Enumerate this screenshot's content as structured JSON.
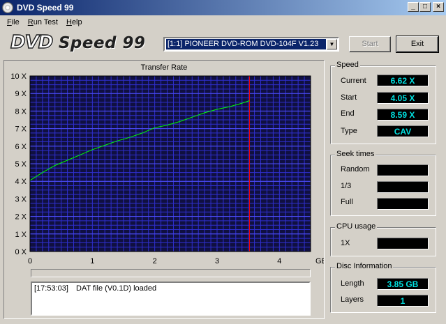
{
  "window": {
    "title": "DVD Speed 99"
  },
  "menu": [
    "File",
    "Run Test",
    "Help"
  ],
  "logo": {
    "dvd": "DVD",
    "rest": "Speed 99"
  },
  "drive": {
    "selected": "[1:1]  PIONEER DVD-ROM DVD-104F V1.23"
  },
  "buttons": {
    "start": "Start",
    "exit": "Exit"
  },
  "log": {
    "time": "[17:53:03]",
    "message": "DAT file (V0.1D) loaded"
  },
  "speed": {
    "title": "Speed",
    "current_label": "Current",
    "current": "6.62 X",
    "start_label": "Start",
    "start": "4.05 X",
    "end_label": "End",
    "end": "8.59 X",
    "type_label": "Type",
    "type": "CAV"
  },
  "seek": {
    "title": "Seek times",
    "random_label": "Random",
    "random": "",
    "third_label": "1/3",
    "third": "",
    "full_label": "Full",
    "full": ""
  },
  "cpu": {
    "title": "CPU usage",
    "label": "1X",
    "value": ""
  },
  "disc": {
    "title": "Disc Information",
    "length_label": "Length",
    "length": "3.85 GB",
    "layers_label": "Layers",
    "layers": "1"
  },
  "chart_data": {
    "type": "line",
    "title": "Transfer Rate",
    "xunit": "GB",
    "xlim": [
      0,
      4.5
    ],
    "ylim": [
      0,
      10
    ],
    "xticks": [
      "0",
      "1",
      "2",
      "3",
      "4"
    ],
    "yticks": [
      "0 X",
      "1 X",
      "2 X",
      "3 X",
      "4 X",
      "5 X",
      "6 X",
      "7 X",
      "8 X",
      "9 X",
      "10 X"
    ],
    "grid": true,
    "marker_x": 3.52,
    "series": [
      {
        "x": [
          0,
          0.2,
          0.4,
          0.6,
          0.8,
          1.0,
          1.2,
          1.4,
          1.6,
          1.8,
          2.0,
          2.2,
          2.4,
          2.6,
          2.8,
          3.0,
          3.2,
          3.4,
          3.52
        ],
        "y": [
          4.05,
          4.5,
          4.9,
          5.2,
          5.5,
          5.8,
          6.05,
          6.3,
          6.5,
          6.75,
          7.05,
          7.2,
          7.4,
          7.65,
          7.9,
          8.1,
          8.25,
          8.45,
          8.59
        ]
      }
    ],
    "colors": {
      "background": "#101040",
      "grid": "#2f2fd0",
      "grid_major": "#5050ff",
      "line": "#00ff00",
      "marker": "#ff0000"
    }
  }
}
